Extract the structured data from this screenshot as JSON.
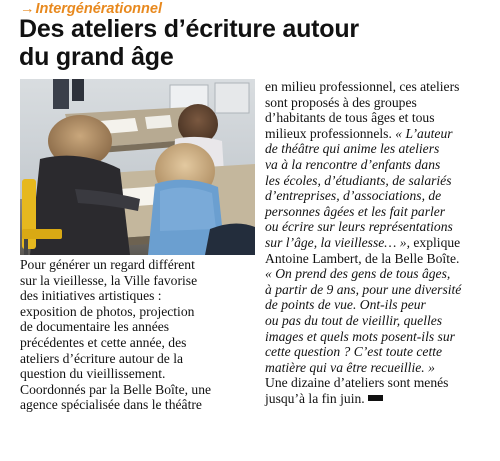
{
  "article": {
    "kicker_arrow": "→",
    "kicker": "Intergénérationnel",
    "title_lines": [
      "Des ateliers d’écriture autour",
      "du grand âge"
    ],
    "left_column": [
      "Pour générer un regard différent",
      "sur la vieillesse, la Ville favorise",
      "des initiatives artistiques :",
      "exposition de photos, projection",
      "de documentaire les années",
      "précédentes et cette année, des",
      "ateliers d’écriture autour de la",
      "question du vieillissement.",
      "Coordonnés par la Belle Boîte, une",
      "agence spécialisée dans le théâtre"
    ],
    "right_column": [
      {
        "text": "en milieu professionnel, ces ateliers",
        "italic": false
      },
      {
        "text": "sont proposés à des groupes",
        "italic": false
      },
      {
        "text": "d’habitants de tous âges et tous",
        "italic": false
      },
      {
        "text": "milieux professionnels. ",
        "italic": false,
        "tail": "« L’auteur",
        "tail_italic": true
      },
      {
        "text": "de théâtre qui anime les ateliers",
        "italic": true
      },
      {
        "text": "va à la rencontre d’enfants dans",
        "italic": true
      },
      {
        "text": "les écoles, d’étudiants, de salariés",
        "italic": true
      },
      {
        "text": "d’entreprises, d’associations, de",
        "italic": true
      },
      {
        "text": "personnes âgées et les fait parler",
        "italic": true
      },
      {
        "text": "ou écrire sur leurs représentations",
        "italic": true
      },
      {
        "text": "sur l’âge, la vieillesse… »",
        "italic": true,
        "tail": ", explique",
        "tail_italic": false
      },
      {
        "text": "Antoine Lambert, de la Belle Boîte.",
        "italic": false
      },
      {
        "text": "« On prend des gens de tous âges,",
        "italic": true
      },
      {
        "text": "à partir de 9 ans, pour une diversité",
        "italic": true
      },
      {
        "text": "de points de vue. Ont-ils peur",
        "italic": true
      },
      {
        "text": "ou pas du tout de vieillir, quelles",
        "italic": true
      },
      {
        "text": "images et quels mots posent-ils sur",
        "italic": true
      },
      {
        "text": "cette question ? C’est toute cette",
        "italic": true
      },
      {
        "text": "matière qui va être recueillie. »",
        "italic": true
      },
      {
        "text": "Une dizaine d’ateliers sont menés",
        "italic": false
      },
      {
        "text": "jusqu’à la fin juin.",
        "italic": false,
        "end_mark": true
      }
    ]
  },
  "colors": {
    "kicker": "#e8891e",
    "text": "#111111"
  }
}
